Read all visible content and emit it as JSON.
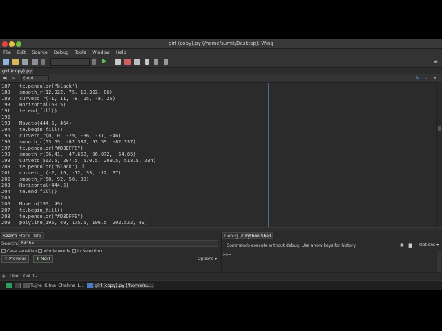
{
  "window": {
    "title": "girl (copy).py (/home/sumit/Desktop): Wing"
  },
  "menu": [
    "File",
    "Edit",
    "Source",
    "Debug",
    "Tools",
    "Window",
    "Help"
  ],
  "tabs": {
    "file_tab": "girl (copy).py"
  },
  "nav": {
    "scope": "(top)"
  },
  "editor": {
    "lines": [
      {
        "n": "187",
        "code": "te.pencolor(\"black\")"
      },
      {
        "n": "188",
        "code": "smooth_r(12.322, 75, 19.322, 86)"
      },
      {
        "n": "189",
        "code": "curveto_r(-1, 11, -8, 25, -8, 25)"
      },
      {
        "n": "190",
        "code": "Horizontal(60.5)"
      },
      {
        "n": "191",
        "code": "te.end_fill()"
      },
      {
        "n": "192",
        "code": ""
      },
      {
        "n": "193",
        "code": "Moveto(444.5, 464)"
      },
      {
        "n": "194",
        "code": "te.begin_fill()"
      },
      {
        "n": "195",
        "code": "curveto_r(0, 0, -29, -36, -31, -46)"
      },
      {
        "n": "196",
        "code": "smooth_r(53.59, -82.337, 53.59, -82.337)"
      },
      {
        "n": "197",
        "code": "te.pencolor(\"#D3DFF0\")"
      },
      {
        "n": "198",
        "code": "smooth_r(86.41, -47.663, 96.072, -54.85)"
      },
      {
        "n": "199",
        "code": "Curveto(563.5, 297.5, 570.5, 299.5, 518.5, 334)"
      },
      {
        "n": "200",
        "code": "te.pencolor(\"black\")"
      },
      {
        "n": "201",
        "code": "curveto_r(-2, 16, -12, 33, -12, 37)"
      },
      {
        "n": "202",
        "code": "smooth_r(50, 92, 50, 93)"
      },
      {
        "n": "203",
        "code": "Horizontal(444.5)"
      },
      {
        "n": "204",
        "code": "te.end_fill()"
      },
      {
        "n": "205",
        "code": ""
      },
      {
        "n": "206",
        "code": "Moveto(195, 49)"
      },
      {
        "n": "207",
        "code": "te.begin_fill()"
      },
      {
        "n": "208",
        "code": "te.pencolor(\"#D3DFF0\")"
      },
      {
        "n": "209",
        "code": "polyline(195, 49, 175.5, 106.5, 202.522, 49)"
      }
    ]
  },
  "search_panel": {
    "tab_search": "Search",
    "tab_stack": "Stack Data",
    "search_label": "Search:",
    "search_value": "#3465",
    "case_sensitive": "Case sensitive",
    "whole_words": "Whole words",
    "in_selection": "In Selection",
    "previous": "Previous",
    "next": "Next",
    "options": "Options"
  },
  "shell_panel": {
    "tab_debug": "Debug I/O",
    "tab_shell": "Python Shell",
    "message": "Commands execute without debug.  Use arrow keys for history.",
    "options": "Options",
    "prompt": ">>>"
  },
  "status": {
    "text": "Line 1 Col 0 -"
  },
  "taskbar": {
    "task1": "Tujhe_Kitna_Chahne_L...",
    "task2": "girl (copy).py (/home/su..."
  },
  "colors": {
    "accent_line": "#4a6a9a",
    "background": "#2b2b2b"
  }
}
